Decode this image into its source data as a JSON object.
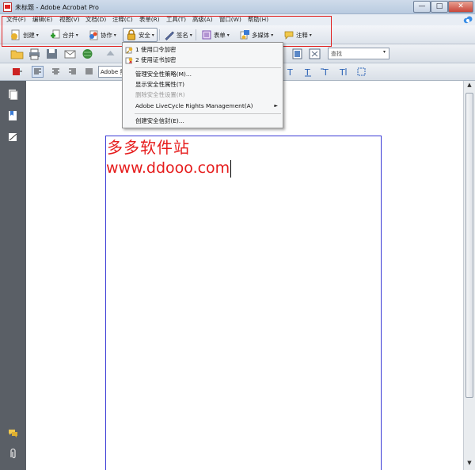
{
  "window": {
    "title": "未标题 - Adobe Acrobat Pro",
    "min": "—",
    "max": "□",
    "close": "✕"
  },
  "menubar": {
    "items": [
      "文件(F)",
      "编辑(E)",
      "视图(V)",
      "文档(D)",
      "注释(C)",
      "表单(R)",
      "工具(T)",
      "高级(A)",
      "窗口(W)",
      "帮助(H)"
    ]
  },
  "toolbar": {
    "create": "创建",
    "combine": "合并",
    "collaborate": "协作",
    "security": "安全",
    "sign": "签名",
    "forms": "表单",
    "multimedia": "多媒体",
    "comment": "注释"
  },
  "toolbar2": {
    "search_placeholder": "查找"
  },
  "toolbar3": {
    "font_value": "Adobe 黑"
  },
  "security_menu": {
    "items": [
      {
        "label": "1 使用口令加密",
        "disabled": false,
        "icon": "key-icon"
      },
      {
        "label": "2 使用证书加密",
        "disabled": false,
        "icon": "certificate-icon"
      },
      {
        "label": "管理安全性策略(M)...",
        "disabled": false
      },
      {
        "label": "显示安全性属性(T)",
        "disabled": false
      },
      {
        "label": "删除安全性设置(R)",
        "disabled": true
      },
      {
        "label": "Adobe LiveCycle Rights Management(A)",
        "disabled": false,
        "submenu": "►"
      },
      {
        "label": "创建安全信封(E)...",
        "disabled": false
      }
    ]
  },
  "document": {
    "line1": "多多软件站",
    "line2": "www.ddooo.com"
  },
  "colors": {
    "highlight_box": "#e02020",
    "doc_text": "#e61c1c",
    "page_border": "#3b3bd6"
  }
}
